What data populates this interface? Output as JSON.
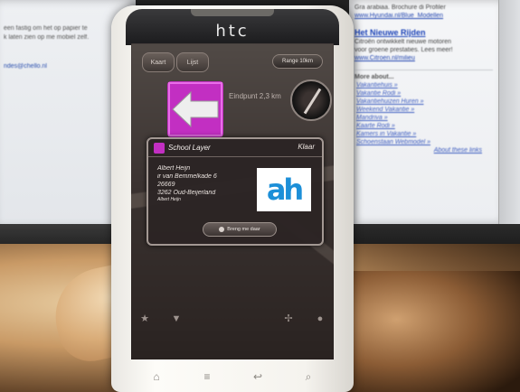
{
  "background": {
    "left_monitor_lines": [
      "een fastig om het op papier te",
      "k laten zien op me mobiel zelf.",
      "",
      "",
      "ndes@chello.nl"
    ],
    "right_monitor": {
      "top_lines": [
        "Gra arabiaa. Brochure di Profiler",
        "www.Hyundai.nl/Blue_Modellen"
      ],
      "headline": "Het Nieuwe Rijden",
      "body": [
        "Citroën ontwikkelt nieuwe motoren",
        "voor groene prestaties. Lees meer!",
        "www.Citroen.nl/milieu"
      ],
      "section_title": "More about...",
      "links": [
        "Vakantiehuis »",
        "Vakantie Rodi »",
        "Vakantiehuizen Huren »",
        "Weekend Vakantie »",
        "Mandriva »",
        "Kaarte Rodi »",
        "Kamers in Vakantie »",
        "Schoenstaan Webmodel »"
      ],
      "footer": "About these links"
    }
  },
  "phone": {
    "brand": "htc",
    "map": {
      "tabs": [
        "Kaart",
        "Lijst"
      ],
      "range_button": "Range 10km",
      "distance_text": "Eindpunt 2,3 km"
    },
    "popup": {
      "title": "School Layer",
      "close_label": "Klaar",
      "address_lines": [
        "Albert Heijn",
        "ir van Bemmelkade 6",
        "26669",
        "3262 Oud-Beijerland"
      ],
      "address_small": "Albert Heijn",
      "logo_text": "ah",
      "go_button": "Breng me daar"
    },
    "bottom_bar": {
      "icons": [
        "star-icon",
        "down-triangle-icon",
        "gear-icon",
        "pin-icon"
      ]
    },
    "hardware_keys": [
      "home-key",
      "menu-key",
      "back-key",
      "search-key"
    ]
  }
}
